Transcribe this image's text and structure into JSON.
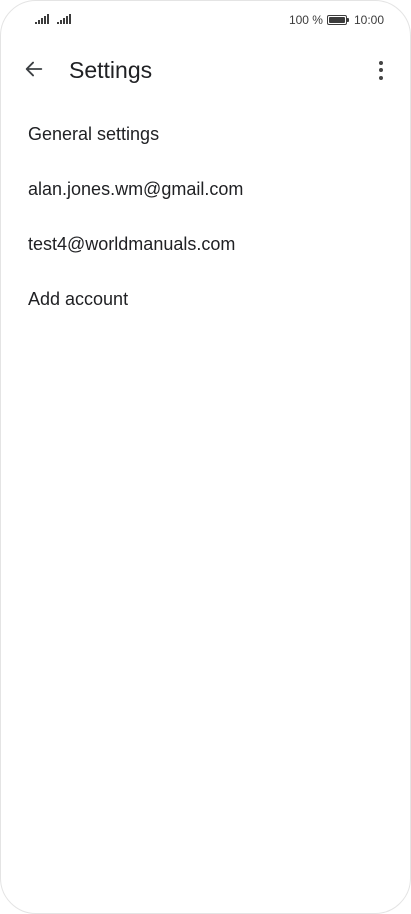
{
  "status_bar": {
    "battery_percent": "100 %",
    "time": "10:00",
    "icons": [
      "signal-icon",
      "signal-icon",
      "battery-icon"
    ]
  },
  "app_bar": {
    "title": "Settings",
    "back_icon": "arrow-left-icon",
    "menu_icon": "more-vert-icon"
  },
  "settings": {
    "items": [
      {
        "label": "General settings"
      },
      {
        "label": "alan.jones.wm@gmail.com"
      },
      {
        "label": "test4@worldmanuals.com"
      },
      {
        "label": "Add account"
      }
    ]
  }
}
